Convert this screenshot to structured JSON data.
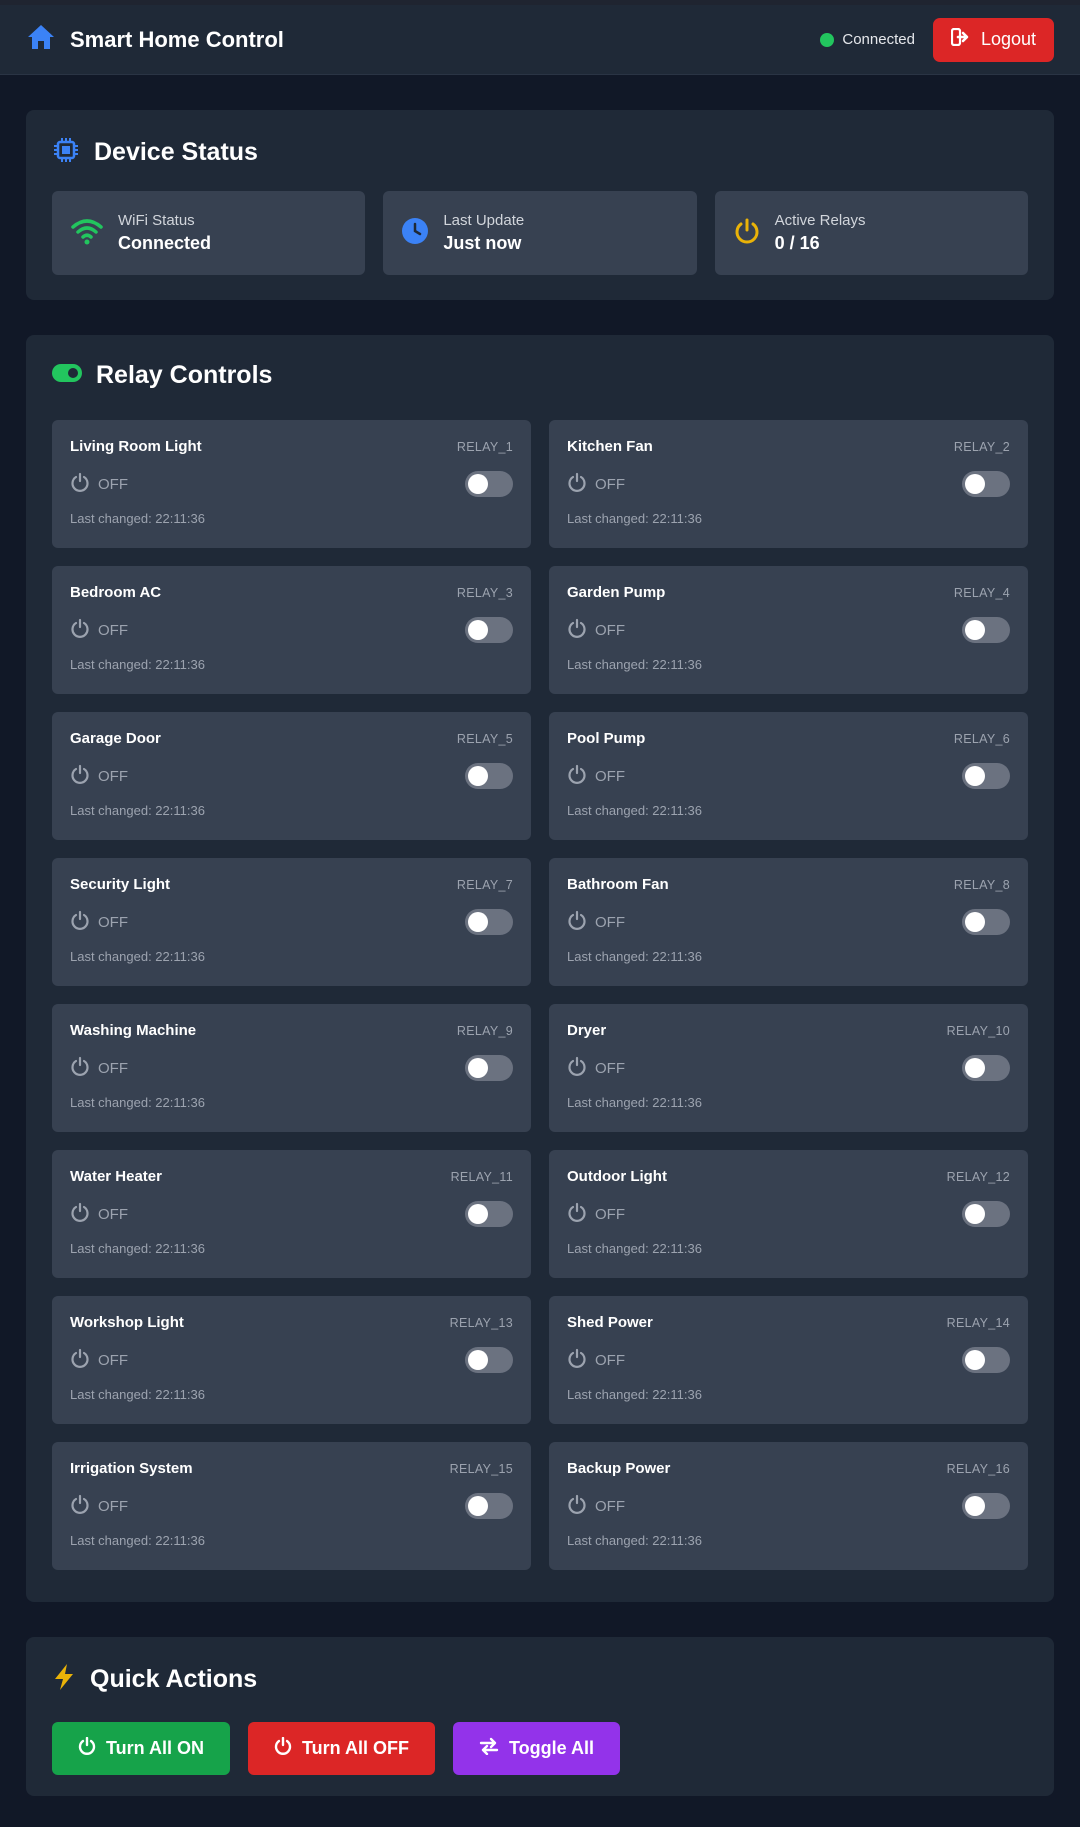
{
  "navbar": {
    "title": "Smart Home Control",
    "connection_text": "Connected",
    "logout_label": "Logout"
  },
  "device_status": {
    "title": "Device Status",
    "stats": [
      {
        "label": "WiFi Status",
        "value": "Connected",
        "icon": "wifi-icon",
        "color": "#22c55e"
      },
      {
        "label": "Last Update",
        "value": "Just now",
        "icon": "clock-icon",
        "color": "#3b82f6"
      },
      {
        "label": "Active Relays",
        "value": "0 / 16",
        "icon": "power-icon",
        "color": "#eab308"
      }
    ]
  },
  "relay_controls": {
    "title": "Relay Controls",
    "relays": [
      {
        "name": "Living Room Light",
        "id": "RELAY_1",
        "state": "OFF",
        "last_changed": "Last changed: 22:11:36"
      },
      {
        "name": "Kitchen Fan",
        "id": "RELAY_2",
        "state": "OFF",
        "last_changed": "Last changed: 22:11:36"
      },
      {
        "name": "Bedroom AC",
        "id": "RELAY_3",
        "state": "OFF",
        "last_changed": "Last changed: 22:11:36"
      },
      {
        "name": "Garden Pump",
        "id": "RELAY_4",
        "state": "OFF",
        "last_changed": "Last changed: 22:11:36"
      },
      {
        "name": "Garage Door",
        "id": "RELAY_5",
        "state": "OFF",
        "last_changed": "Last changed: 22:11:36"
      },
      {
        "name": "Pool Pump",
        "id": "RELAY_6",
        "state": "OFF",
        "last_changed": "Last changed: 22:11:36"
      },
      {
        "name": "Security Light",
        "id": "RELAY_7",
        "state": "OFF",
        "last_changed": "Last changed: 22:11:36"
      },
      {
        "name": "Bathroom Fan",
        "id": "RELAY_8",
        "state": "OFF",
        "last_changed": "Last changed: 22:11:36"
      },
      {
        "name": "Washing Machine",
        "id": "RELAY_9",
        "state": "OFF",
        "last_changed": "Last changed: 22:11:36"
      },
      {
        "name": "Dryer",
        "id": "RELAY_10",
        "state": "OFF",
        "last_changed": "Last changed: 22:11:36"
      },
      {
        "name": "Water Heater",
        "id": "RELAY_11",
        "state": "OFF",
        "last_changed": "Last changed: 22:11:36"
      },
      {
        "name": "Outdoor Light",
        "id": "RELAY_12",
        "state": "OFF",
        "last_changed": "Last changed: 22:11:36"
      },
      {
        "name": "Workshop Light",
        "id": "RELAY_13",
        "state": "OFF",
        "last_changed": "Last changed: 22:11:36"
      },
      {
        "name": "Shed Power",
        "id": "RELAY_14",
        "state": "OFF",
        "last_changed": "Last changed: 22:11:36"
      },
      {
        "name": "Irrigation System",
        "id": "RELAY_15",
        "state": "OFF",
        "last_changed": "Last changed: 22:11:36"
      },
      {
        "name": "Backup Power",
        "id": "RELAY_16",
        "state": "OFF",
        "last_changed": "Last changed: 22:11:36"
      }
    ]
  },
  "quick_actions": {
    "title": "Quick Actions",
    "buttons": [
      {
        "label": "Turn All ON",
        "color": "#16a34a",
        "icon": "power-icon"
      },
      {
        "label": "Turn All OFF",
        "color": "#dc2626",
        "icon": "power-icon"
      },
      {
        "label": "Toggle All",
        "color": "#9333ea",
        "icon": "swap-arrows-icon"
      }
    ]
  },
  "colors": {
    "background": "#111827",
    "card": "#1f2937",
    "tile": "#374151",
    "accent_blue": "#3b82f6",
    "accent_green": "#22c55e"
  }
}
